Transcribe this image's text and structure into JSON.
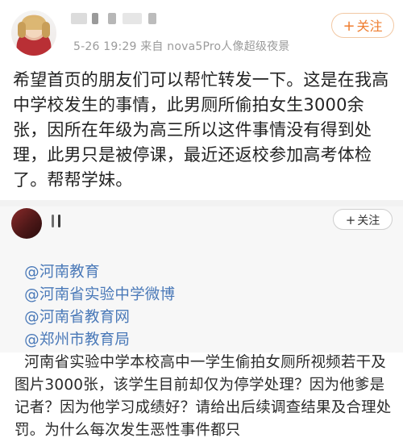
{
  "post": {
    "meta": "5-26 19:29  来自 nova5Pro人像超级夜景",
    "follow_plus": "+",
    "follow_label": "关注",
    "content": "希望首页的朋友们可以帮忙转发一下。这是在我高中学校发生的事情，此男厕所偷拍女生3000余张，因所在年级为高三所以这件事情没有得到处理，此男只是被停课，最近还返校参加高考体检了。帮帮学妹。"
  },
  "repost": {
    "follow_plus": "+",
    "follow_label": "关注",
    "mentions": [
      "@河南教育",
      "@河南省实验中学微博",
      "@河南省教育网",
      "@郑州市教育局"
    ],
    "body": "河南省实验中学本校高中一学生偷拍女厕所视频若干及图片3000张，该学生目前却仅为停学处理？因为他爹是记者？因为他学习成绩好？请给出后续调查结果及合理处罚。为什么每次发生恶性事件都只"
  },
  "colors": {
    "mention": "#4a79b8",
    "follow_orange": "#ef7d2f"
  }
}
